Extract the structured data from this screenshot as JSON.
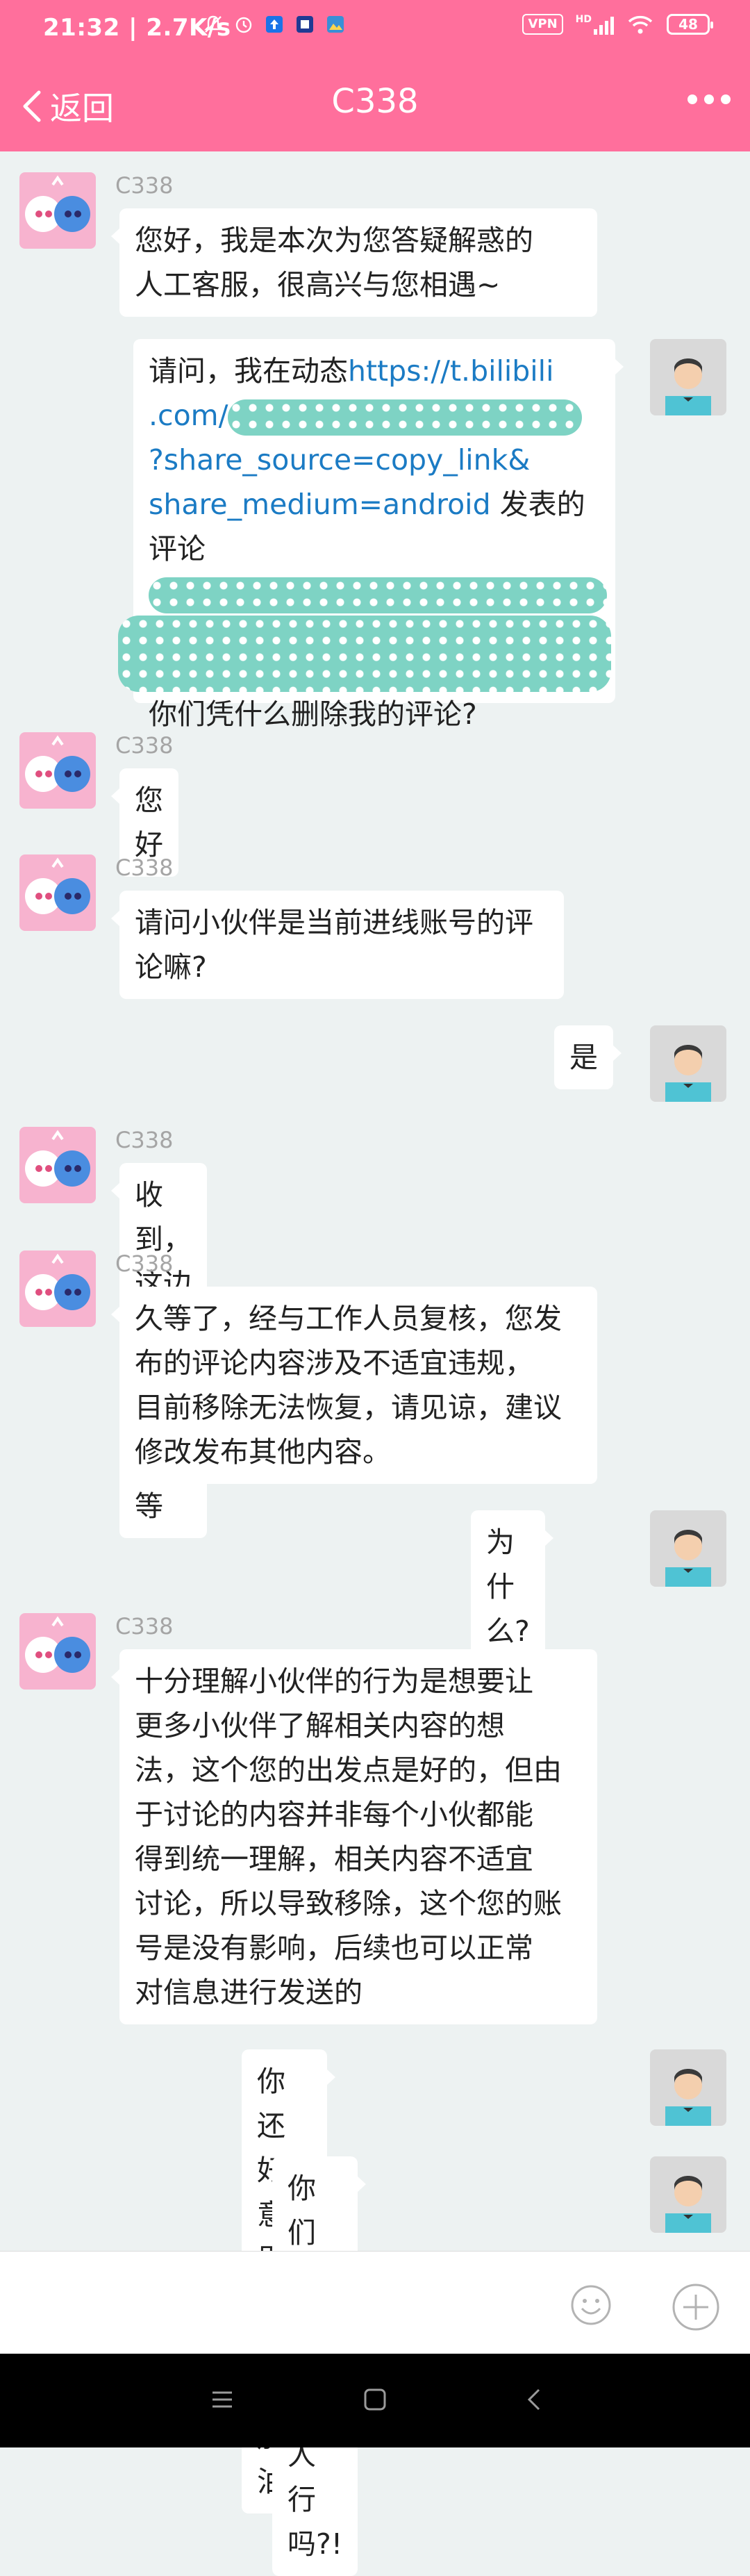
{
  "status_bar": {
    "time_speed": "21:32 | 2.7K/s",
    "vpn": "VPN",
    "network": "HD",
    "battery": "48"
  },
  "header": {
    "back_label": "返回",
    "title": "C338"
  },
  "messages": [
    {
      "side": "left",
      "name": "C338",
      "lines": "您好，我是本次为您答疑解惑的\n人工客服，很高兴与您相遇~"
    },
    {
      "side": "right",
      "intro": "请问，我在动态",
      "link1": "https://t.bilibili",
      "link2": ".com/",
      "link3": "?share_source=copy_link&",
      "link4": "share_medium=android",
      "after_link": " 发表的",
      "line5": "评论",
      "last": "你们凭什么删除我的评论?"
    },
    {
      "side": "left",
      "name": "C338",
      "lines": "您好"
    },
    {
      "side": "left",
      "name": "C338",
      "lines": "请问小伙伴是当前进线账号的评\n论嘛?"
    },
    {
      "side": "right",
      "lines": "是"
    },
    {
      "side": "left",
      "name": "C338",
      "lines": "收到，这边查看一下，请稍等"
    },
    {
      "side": "left",
      "name": "C338",
      "lines": "久等了，经与工作人员复核，您发\n布的评论内容涉及不适宜违规，\n目前移除无法恢复，请见谅，建议\n修改发布其他内容。"
    },
    {
      "side": "right",
      "lines": "为什么?"
    },
    {
      "side": "left",
      "name": "C338",
      "lines": "十分理解小伙伴的行为是想要让\n更多小伙伴了解相关内容的想\n法，这个您的出发点是好的，但由\n于讨论的内容并非每个小伙都能\n得到统一理解，相关内容不适宜\n讨论，所以导致移除，这个您的账\n号是没有影响，后续也可以正常\n对信息进行发送的"
    },
    {
      "side": "right",
      "lines": "你还好意思为四川加油?!"
    },
    {
      "side": "right",
      "lines": "你们平台做点人行吗?!"
    }
  ],
  "colors": {
    "brand": "#ff6f9c",
    "chat_bg": "#edf2f2",
    "link": "#1b7bc4",
    "redaction": "#7ed3c4"
  },
  "icons": [
    "chevron-left-icon",
    "more-dots-icon",
    "emoji-icon",
    "plus-icon",
    "menu-icon",
    "home-icon",
    "back-triangle-icon",
    "user-avatar-icon",
    "agent-avatar-icon"
  ]
}
